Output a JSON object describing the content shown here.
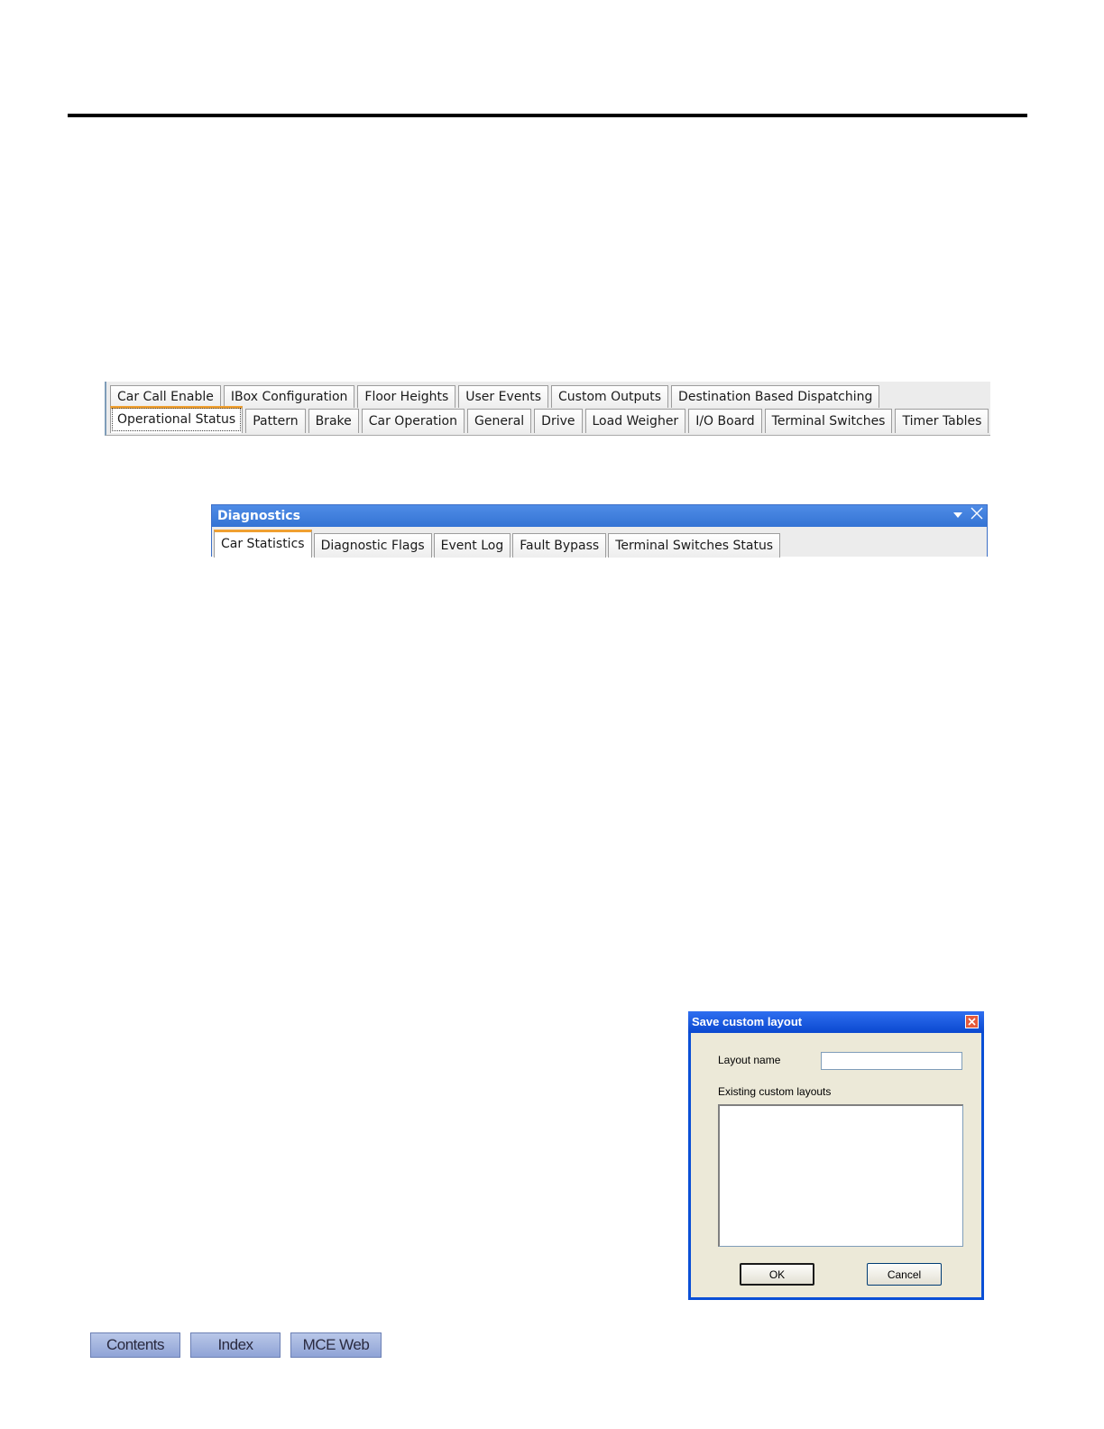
{
  "tabstrip1": {
    "row1": [
      "Car Call Enable",
      "IBox Configuration",
      "Floor Heights",
      "User Events",
      "Custom Outputs",
      "Destination Based Dispatching"
    ],
    "row2": [
      "Operational Status",
      "Pattern",
      "Brake",
      "Car Operation",
      "General",
      "Drive",
      "Load Weigher",
      "I/O Board",
      "Terminal Switches",
      "Timer Tables"
    ],
    "active": "Operational Status"
  },
  "diagnostics": {
    "title": "Diagnostics",
    "tabs": [
      "Car Statistics",
      "Diagnostic Flags",
      "Event Log",
      "Fault Bypass",
      "Terminal Switches Status"
    ],
    "active": "Car Statistics",
    "icons": [
      "dropdown-arrow-icon",
      "close-icon"
    ]
  },
  "dialog": {
    "title": "Save custom layout",
    "layout_name_label": "Layout name",
    "layout_name_value": "",
    "existing_label": "Existing custom layouts",
    "ok_label": "OK",
    "cancel_label": "Cancel",
    "close_icon": "close-icon"
  },
  "footer_nav": {
    "contents": "Contents",
    "index": "Index",
    "mce_web": "MCE Web"
  },
  "colors": {
    "accent_tab": "#f0a030",
    "diag_title_bg": "#3474d4",
    "dialog_title_bg": "#0a48d0",
    "nav_button_bg": "#a9b9e0"
  }
}
